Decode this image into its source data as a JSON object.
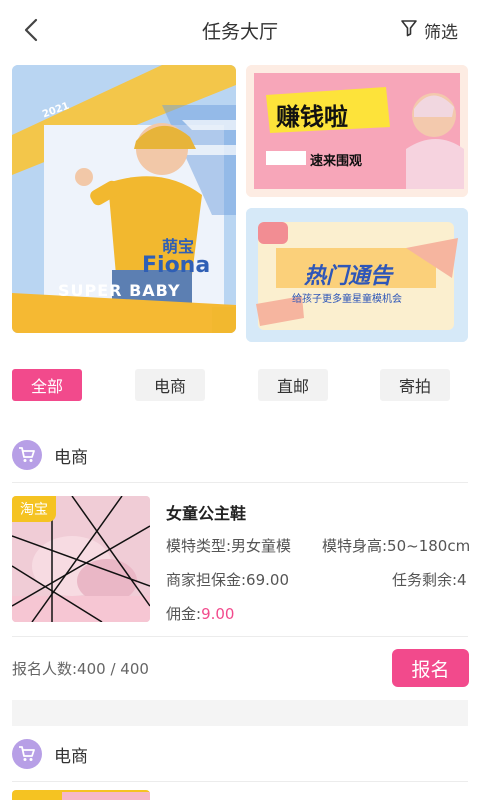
{
  "header": {
    "title": "任务大厅",
    "filter_label": "筛选"
  },
  "banners": {
    "main": {
      "year": "2021",
      "name_cn": "萌宝",
      "name_en": "Fiona",
      "tagline": "SUPER BABY"
    },
    "top": {
      "headline": "赚钱啦",
      "sub": "速来围观"
    },
    "bottom": {
      "headline": "热门通告",
      "sub": "给孩子更多童星童模机会"
    }
  },
  "tabs": [
    {
      "label": "全部",
      "active": true
    },
    {
      "label": "电商",
      "active": false
    },
    {
      "label": "直邮",
      "active": false
    },
    {
      "label": "寄拍",
      "active": false
    }
  ],
  "sections": [
    {
      "label": "电商",
      "icon": "cart-icon",
      "task": {
        "badge": "淘宝",
        "title": "女童公主鞋",
        "model_type": "模特类型:男女童模",
        "model_height": "模特身高:50~180cm",
        "deposit": "商家担保金:69.00",
        "remaining": "任务剩余:4",
        "commission_label": "佣金:",
        "commission_value": "9.00",
        "signup_count": "报名人数:400 / 400",
        "signup_button": "报名"
      }
    },
    {
      "label": "电商",
      "icon": "cart-icon"
    }
  ],
  "colors": {
    "accent": "#f24a8c",
    "badge": "#f5c322",
    "section_icon": "#b79fe6"
  }
}
